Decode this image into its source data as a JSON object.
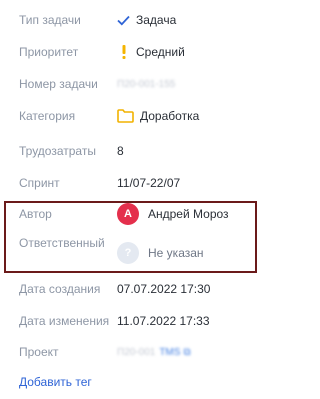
{
  "fields": {
    "task_type": {
      "label": "Тип задачи",
      "value": "Задача",
      "icon": "check-icon"
    },
    "priority": {
      "label": "Приоритет",
      "value": "Средний",
      "icon": "exclamation-icon",
      "icon_color": "#f4b400"
    },
    "task_number": {
      "label": "Номер задачи",
      "value": "П20-001-155"
    },
    "category": {
      "label": "Категория",
      "value": "Доработка",
      "icon": "folder-icon",
      "icon_color": "#f2b200"
    },
    "effort": {
      "label": "Трудозатраты",
      "value": "8"
    },
    "sprint": {
      "label": "Спринт",
      "value": "11/07-22/07"
    },
    "author": {
      "label": "Автор",
      "value": "Андрей Мороз",
      "avatar_initial": "А",
      "avatar_color": "#e42f4c"
    },
    "assignee": {
      "label": "Ответственный",
      "value": "Не указан",
      "avatar_initial": "?"
    },
    "created": {
      "label": "Дата создания",
      "value": "07.07.2022 17:30"
    },
    "modified": {
      "label": "Дата изменения",
      "value": "11.07.2022 17:33"
    },
    "project": {
      "label": "Проект",
      "value": "П20-001",
      "link": "TMS"
    }
  },
  "add_tag_label": "Добавить тег",
  "highlight_color": "#6b1a1a"
}
